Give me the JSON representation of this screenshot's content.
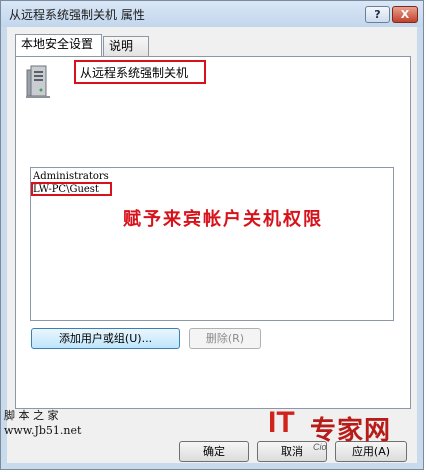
{
  "window": {
    "title": "从远程系统强制关机 属性",
    "help_button": "?",
    "close_button": "X"
  },
  "tabs": [
    {
      "label": "本地安全设置",
      "active": true
    },
    {
      "label": "说明",
      "active": false
    }
  ],
  "policy": {
    "name": "从远程系统强制关机",
    "icon": "server-icon"
  },
  "accounts": [
    "Administrators",
    "LW-PC\\Guest"
  ],
  "annotation": "赋予来宾帐户关机权限",
  "buttons": {
    "add": "添加用户或组(U)...",
    "remove": "删除(R)",
    "ok": "确定",
    "cancel": "取消",
    "apply": "应用(A)"
  },
  "watermarks": {
    "left_line1": "脚 本 之 家",
    "left_line2": "www.Jb51.net",
    "right_it": "IT",
    "right_zh": "专家网",
    "right_en": "Cio"
  },
  "colors": {
    "highlight": "#d8121b",
    "title_bar": "#c9daec",
    "primary_button": "#bee6fd"
  }
}
